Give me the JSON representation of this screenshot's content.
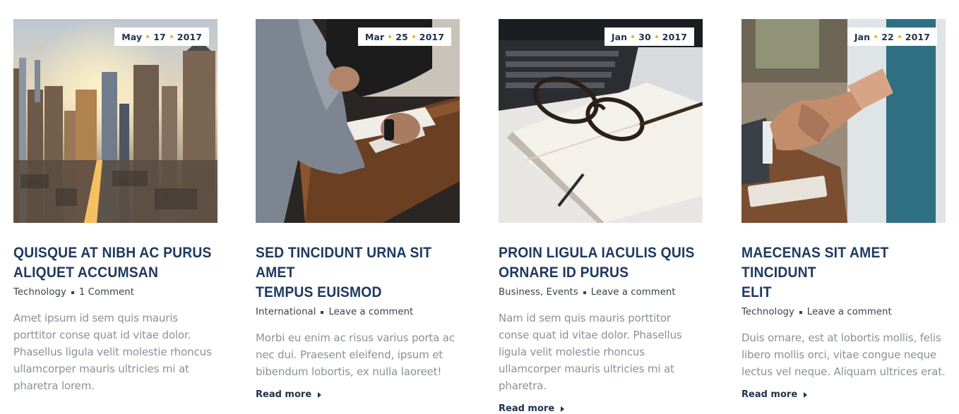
{
  "posts": [
    {
      "image": "city-skyline-sunrise",
      "date": {
        "month": "May",
        "day": "17",
        "year": "2017"
      },
      "title_lines": [
        "QUISQUE AT NIBH AC PURUS",
        "ALIQUET ACCUMSAN"
      ],
      "categories": "Technology",
      "comments": "1 Comment",
      "excerpt": "Amet ipsum id sem quis mauris porttitor conse quat id vitae dolor. Phasellus ligula velit molestie rhoncus ullamcorper mauris ultricies mi at pharetra lorem.",
      "read_more": null
    },
    {
      "image": "person-writing-at-desk",
      "date": {
        "month": "Mar",
        "day": "25",
        "year": "2017"
      },
      "title_lines": [
        "SED TINCIDUNT URNA SIT AMET",
        "TEMPUS EUISMOD"
      ],
      "categories": "International",
      "comments": "Leave a comment",
      "excerpt": "Morbi eu enim ac risus varius porta ac nec dui. Praesent eleifend, ipsum et bibendum lobortis, ex nulla laoreet!",
      "read_more": "Read more"
    },
    {
      "image": "glasses-on-notebook-laptop",
      "date": {
        "month": "Jan",
        "day": "30",
        "year": "2017"
      },
      "title_lines": [
        "PROIN LIGULA IACULIS QUIS",
        "ORNARE ID PURUS"
      ],
      "categories": "Business, Events",
      "comments": "Leave a comment",
      "excerpt": "Nam id sem quis mauris porttitor conse quat id vitae dolor. Phasellus ligula velit molestie rhoncus ullamcorper mauris ultricies mi at pharetra.",
      "read_more": "Read more"
    },
    {
      "image": "business-handshake",
      "date": {
        "month": "Jan",
        "day": "22",
        "year": "2017"
      },
      "title_lines": [
        "MAECENAS SIT AMET TINCIDUNT",
        "ELIT"
      ],
      "categories": "Technology",
      "comments": "Leave a comment",
      "excerpt": "Duis ornare, est at lobortis mollis, felis libero mollis orci, vitae congue neque lectus vel neque. Aliquam ultrices erat.",
      "read_more": "Read more"
    }
  ],
  "colors": {
    "accent_dot": "#f2b01e",
    "title": "#1f3a60",
    "excerpt": "#8b9099"
  }
}
